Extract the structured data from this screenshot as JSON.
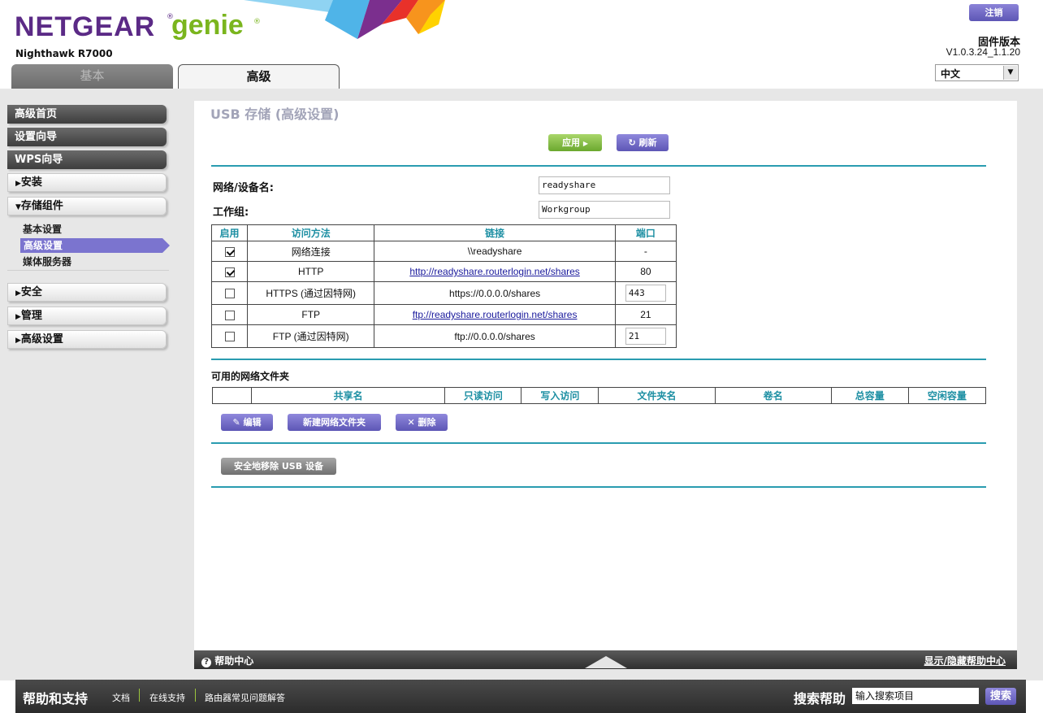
{
  "brand": {
    "name": "NETGEAR",
    "sub": "genie",
    "model": "Nighthawk R7000"
  },
  "header": {
    "logout_label": "注销",
    "firmware_label": "固件版本",
    "firmware_version": "V1.0.3.24_1.1.20",
    "language": "中文"
  },
  "tabs": [
    {
      "label": "基本",
      "active": false
    },
    {
      "label": "高级",
      "active": true
    }
  ],
  "sidebar": {
    "dark_items": [
      "高级首页",
      "设置向导",
      "WPS向导"
    ],
    "install": "安装",
    "storage": "存储组件",
    "storage_sub": [
      "基本设置",
      "高级设置",
      "媒体服务器"
    ],
    "more": [
      "安全",
      "管理",
      "高级设置"
    ]
  },
  "page": {
    "title": "USB 存储 (高级设置)",
    "apply_label": "应用",
    "refresh_label": "刷新",
    "device_name_label": "网络/设备名:",
    "device_name_value": "readyshare",
    "workgroup_label": "工作组:",
    "workgroup_value": "Workgroup"
  },
  "access_table": {
    "headers": [
      "启用",
      "访问方法",
      "链接",
      "端口"
    ],
    "rows": [
      {
        "enabled": true,
        "method": "网络连接",
        "link": "\\\\readyshare",
        "link_is_url": false,
        "port": "-"
      },
      {
        "enabled": true,
        "method": "HTTP",
        "link": "http://readyshare.routerlogin.net/shares",
        "link_is_url": true,
        "port": "80"
      },
      {
        "enabled": false,
        "method": "HTTPS (通过因特网)",
        "link": "https://0.0.0.0/shares",
        "link_is_url": false,
        "port": "443",
        "port_editable": true
      },
      {
        "enabled": false,
        "method": "FTP",
        "link": "ftp://readyshare.routerlogin.net/shares",
        "link_is_url": true,
        "port": "21"
      },
      {
        "enabled": false,
        "method": "FTP (通过因特网)",
        "link": "ftp://0.0.0.0/shares",
        "link_is_url": false,
        "port": "21",
        "port_editable": true
      }
    ]
  },
  "folders": {
    "title": "可用的网络文件夹",
    "headers": [
      "",
      "共享名",
      "只读访问",
      "写入访问",
      "文件夹名",
      "卷名",
      "总容量",
      "空闲容量"
    ],
    "edit_label": "编辑",
    "new_label": "新建网络文件夹",
    "delete_label": "删除",
    "safe_remove_label": "安全地移除 USB 设备"
  },
  "helpbar": {
    "label": "帮助中心",
    "toggle_label": "显示/隐藏帮助中心"
  },
  "footer": {
    "title": "帮助和支持",
    "links": [
      "文档",
      "在线支持",
      "路由器常见问题解答"
    ],
    "search_title": "搜索帮助",
    "search_placeholder": "输入搜索项目",
    "search_button": "搜索"
  },
  "colors": {
    "purple": "#5b2a86",
    "green": "#7ab51d",
    "teal": "#2a9cb0",
    "button_purple": "#6c64c4"
  }
}
